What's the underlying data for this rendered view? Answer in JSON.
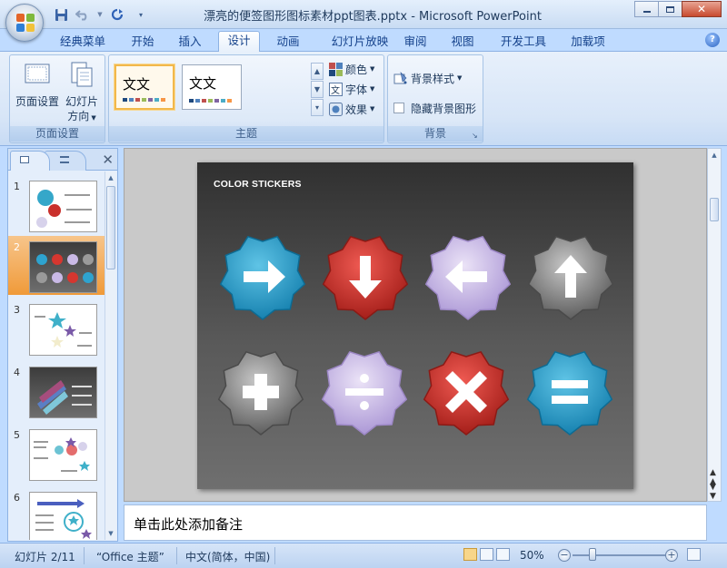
{
  "window": {
    "title": "漂亮的便签图形图标素材ppt图表.pptx - Microsoft PowerPoint"
  },
  "tabs": [
    {
      "label": "经典菜单",
      "active": false
    },
    {
      "label": "开始",
      "active": false
    },
    {
      "label": "插入",
      "active": false
    },
    {
      "label": "设计",
      "active": true
    },
    {
      "label": "动画",
      "active": false
    },
    {
      "label": "幻灯片放映",
      "active": false
    },
    {
      "label": "审阅",
      "active": false
    },
    {
      "label": "视图",
      "active": false
    },
    {
      "label": "开发工具",
      "active": false
    },
    {
      "label": "加载项",
      "active": false
    }
  ],
  "ribbon": {
    "page_setup": {
      "group_label": "页面设置",
      "page_setup_label": "页面设置",
      "orientation_label_line1": "幻灯片",
      "orientation_label_line2": "方向"
    },
    "themes": {
      "group_label": "主题",
      "thumb_text": "文文",
      "colors_label": "颜色",
      "fonts_label": "字体",
      "effects_label": "效果"
    },
    "background": {
      "group_label": "背景",
      "styles_label": "背景样式",
      "hide_graphics_label": "隐藏背景图形",
      "hide_graphics_checked": false
    }
  },
  "slide_panel": {
    "slides": [
      {
        "number": "1",
        "selected": false
      },
      {
        "number": "2",
        "selected": true
      },
      {
        "number": "3",
        "selected": false
      },
      {
        "number": "4",
        "selected": false
      },
      {
        "number": "5",
        "selected": false
      },
      {
        "number": "6",
        "selected": false
      }
    ]
  },
  "slide": {
    "title": "COLOR STICKERS",
    "stickers": [
      {
        "symbol": "arrow-right",
        "color": "#2ea3cf"
      },
      {
        "symbol": "arrow-down",
        "color": "#d5362f"
      },
      {
        "symbol": "arrow-left",
        "color": "#c9b9e6"
      },
      {
        "symbol": "arrow-up",
        "color": "#8a8a8a"
      },
      {
        "symbol": "plus",
        "color": "#8a8a8a"
      },
      {
        "symbol": "divide",
        "color": "#c9b9e6"
      },
      {
        "symbol": "multiply",
        "color": "#d5362f"
      },
      {
        "symbol": "equals",
        "color": "#2ea3cf"
      }
    ]
  },
  "notes": {
    "placeholder": "单击此处添加备注"
  },
  "status": {
    "slide_info": "幻灯片 2/11",
    "theme": "“Office 主题”",
    "language": "中文(简体，中国)",
    "zoom": "50%"
  }
}
